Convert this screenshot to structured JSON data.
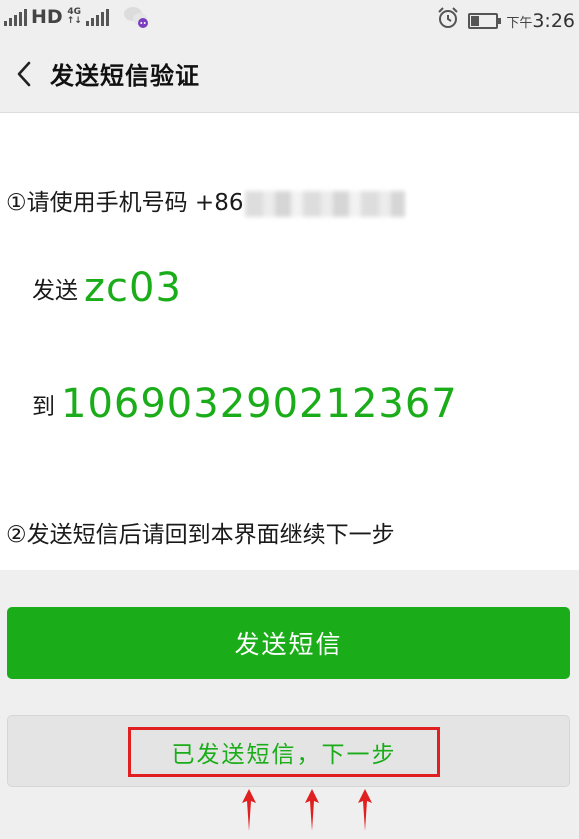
{
  "status_bar": {
    "network_type": "HD",
    "net_sub": "4G",
    "time_prefix": "下午",
    "time": "3:26",
    "icons": [
      "signal-icon",
      "wechat-notification-icon",
      "alarm-icon",
      "battery-icon"
    ]
  },
  "nav": {
    "title": "发送短信验证",
    "back_icon": "chevron-left-icon"
  },
  "content": {
    "step1_marker": "①",
    "step1_text": "请使用手机号码 +86",
    "send_prefix": "发送",
    "send_code": "zc03",
    "to_prefix": "到",
    "to_number": "106903290212367",
    "step2_marker": "②",
    "step2_text": "发送短信后请回到本界面继续下一步"
  },
  "buttons": {
    "send_sms_label": "发送短信",
    "next_label": "已发送短信，下一步"
  },
  "colors": {
    "accent_green": "#1aad19",
    "annotation_red": "#e02020",
    "background": "#efefef"
  },
  "battery_level": 0.3
}
